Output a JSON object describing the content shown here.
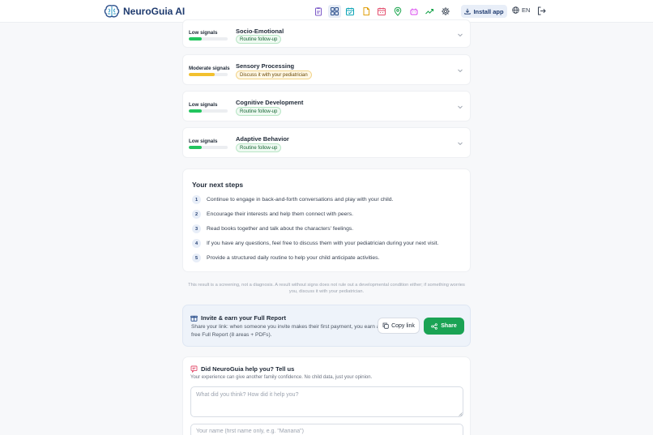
{
  "app": {
    "logo_name": "NeuroGuia",
    "logo_suffix": "AI",
    "install_label": "Install app",
    "lang_label": "EN"
  },
  "nav": {
    "icons": [
      "clipboard-icon",
      "grid-icon",
      "calendar-check-icon",
      "document-icon",
      "calendar-icon",
      "map-pin-icon",
      "toy-icon",
      "trend-icon",
      "gear-icon"
    ]
  },
  "areas": [
    {
      "signal": "Low signals",
      "level": 0.33,
      "color": "#22c55e",
      "title": "Socio-Emotional",
      "badge": "Routine follow-up",
      "badge_type": "green"
    },
    {
      "signal": "Moderate signals",
      "level": 0.66,
      "color": "#f2c12e",
      "title": "Sensory Processing",
      "badge": "Discuss it with your pediatrician",
      "badge_type": "amber"
    },
    {
      "signal": "Low signals",
      "level": 0.33,
      "color": "#22c55e",
      "title": "Cognitive Development",
      "badge": "Routine follow-up",
      "badge_type": "green"
    },
    {
      "signal": "Low signals",
      "level": 0.33,
      "color": "#22c55e",
      "title": "Adaptive Behavior",
      "badge": "Routine follow-up",
      "badge_type": "green"
    }
  ],
  "next_steps": {
    "title": "Your next steps",
    "items": [
      {
        "num": "1",
        "text": "Continue to engage in back-and-forth conversations and play with your child."
      },
      {
        "num": "2",
        "text": "Encourage their interests and help them connect with peers."
      },
      {
        "num": "3",
        "text": "Read books together and talk about the characters' feelings."
      },
      {
        "num": "4",
        "text": "If you have any questions, feel free to discuss them with your pediatrician during your next visit."
      },
      {
        "num": "5",
        "text": "Provide a structured daily routine to help your child anticipate activities."
      }
    ]
  },
  "disclaimer": "This result is a screening, not a diagnosis. A result without signs does not rule out a developmental condition either; if something worries you, discuss it with your pediatrician.",
  "invite": {
    "title": "Invite & earn your Full Report",
    "desc": "Share your link: when someone you invite makes their first payment, you earn a free Full Report (8 areas + PDFs).",
    "copy_label": "Copy link",
    "share_label": "Share"
  },
  "feedback": {
    "title": "Did NeuroGuia help you? Tell us",
    "subtitle": "Your experience can give another family confidence. No child data, just your opinion.",
    "text_placeholder": "What did you think? How did it help you?",
    "name_placeholder": "Your name (first name only, e.g. \"Mariana\")"
  },
  "colors": {
    "brand": "#1e3a6e",
    "accent_green": "#1aa354",
    "signal_low": "#22c55e",
    "signal_moderate": "#f2c12e"
  }
}
